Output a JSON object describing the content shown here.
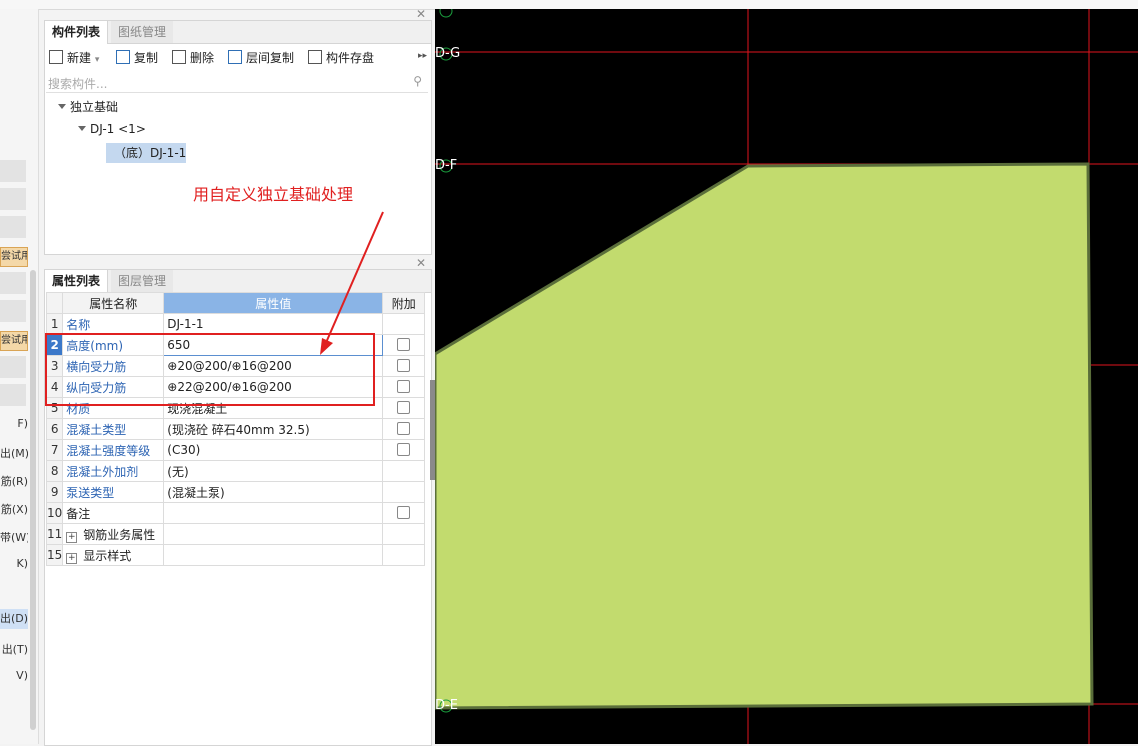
{
  "component_panel": {
    "tabs": [
      "构件列表",
      "图纸管理"
    ],
    "toolbar": {
      "new_label": "新建",
      "copy_label": "复制",
      "delete_label": "删除",
      "floor_copy_label": "层间复制",
      "save_label": "构件存盘"
    },
    "search_placeholder": "搜索构件...",
    "tree": {
      "root": "独立基础",
      "child": "DJ-1 <1>",
      "leaf": "（底）DJ-1-1"
    }
  },
  "property_panel": {
    "tabs": [
      "属性列表",
      "图层管理"
    ],
    "headers": {
      "name": "属性名称",
      "value": "属性值",
      "extra": "附加"
    },
    "rows": [
      {
        "num": "1",
        "name": "名称",
        "value": "DJ-1-1",
        "check": false
      },
      {
        "num": "2",
        "name": "高度(mm)",
        "value": "650",
        "check": true
      },
      {
        "num": "3",
        "name": "横向受力筋",
        "value": "⊕20@200/⊕16@200",
        "check": true
      },
      {
        "num": "4",
        "name": "纵向受力筋",
        "value": "⊕22@200/⊕16@200",
        "check": true
      },
      {
        "num": "5",
        "name": "材质",
        "value": "现浇混凝土",
        "check": true
      },
      {
        "num": "6",
        "name": "混凝土类型",
        "value": "(现浇砼 碎石40mm 32.5)",
        "check": true
      },
      {
        "num": "7",
        "name": "混凝土强度等级",
        "value": "(C30)",
        "check": true
      },
      {
        "num": "8",
        "name": "混凝土外加剂",
        "value": "(无)",
        "check": false
      },
      {
        "num": "9",
        "name": "泵送类型",
        "value": "(混凝土泵)",
        "check": false
      },
      {
        "num": "10",
        "name": "备注",
        "value": "",
        "check": true
      },
      {
        "num": "11",
        "name": "钢筋业务属性",
        "value": "",
        "check": false
      },
      {
        "num": "15",
        "name": "显示样式",
        "value": "",
        "check": false
      }
    ]
  },
  "annotation": "用自定义独立基础处理",
  "left_strip_labels": [
    "尝试用",
    "尝试用",
    "F)",
    "出(M)",
    "筋(R)",
    "筋(X)",
    "带(W)",
    "K)",
    "出(D)",
    "出(T)",
    "V)"
  ],
  "canvas": {
    "axis_labels": [
      "D-G",
      "D-F",
      "D-E"
    ],
    "shape_color": "#c2db6e",
    "grid_color": "#e0141e",
    "background": "#000000"
  }
}
